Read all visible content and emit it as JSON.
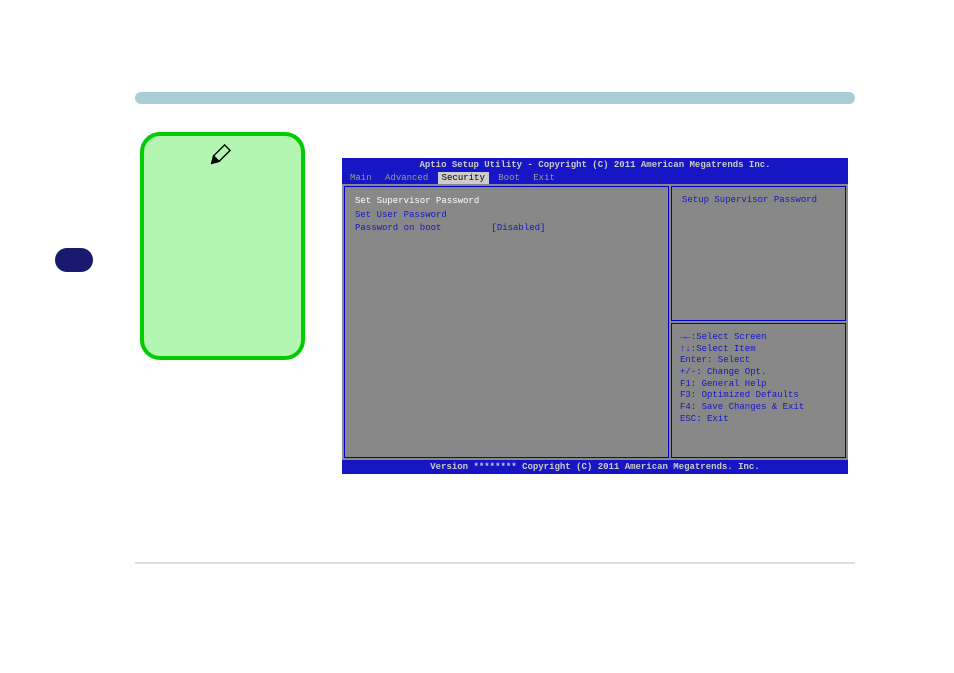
{
  "bios": {
    "header": "Aptio Setup Utility - Copyright (C) 2011 American Megatrends Inc.",
    "footer": "Version ******** Copyright (C) 2011 American Megatrends. Inc.",
    "tabs": [
      "Main",
      "Advanced",
      "Security",
      "Boot",
      "Exit"
    ],
    "menu": {
      "item0": "Set Supervisor Password",
      "item1": "Set User Password",
      "item2_label": "Password on boot",
      "item2_value": "[Disabled]"
    },
    "help_text": "Setup Supervisor Password",
    "keys": {
      "k0": "→←:Select Screen",
      "k1": "↑↓:Select Item",
      "k2": "Enter: Select",
      "k3": "+/-: Change Opt.",
      "k4": "F1: General Help",
      "k5": "F3: Optimized Defaults",
      "k6": "F4: Save Changes & Exit",
      "k7": "ESC: Exit"
    }
  }
}
